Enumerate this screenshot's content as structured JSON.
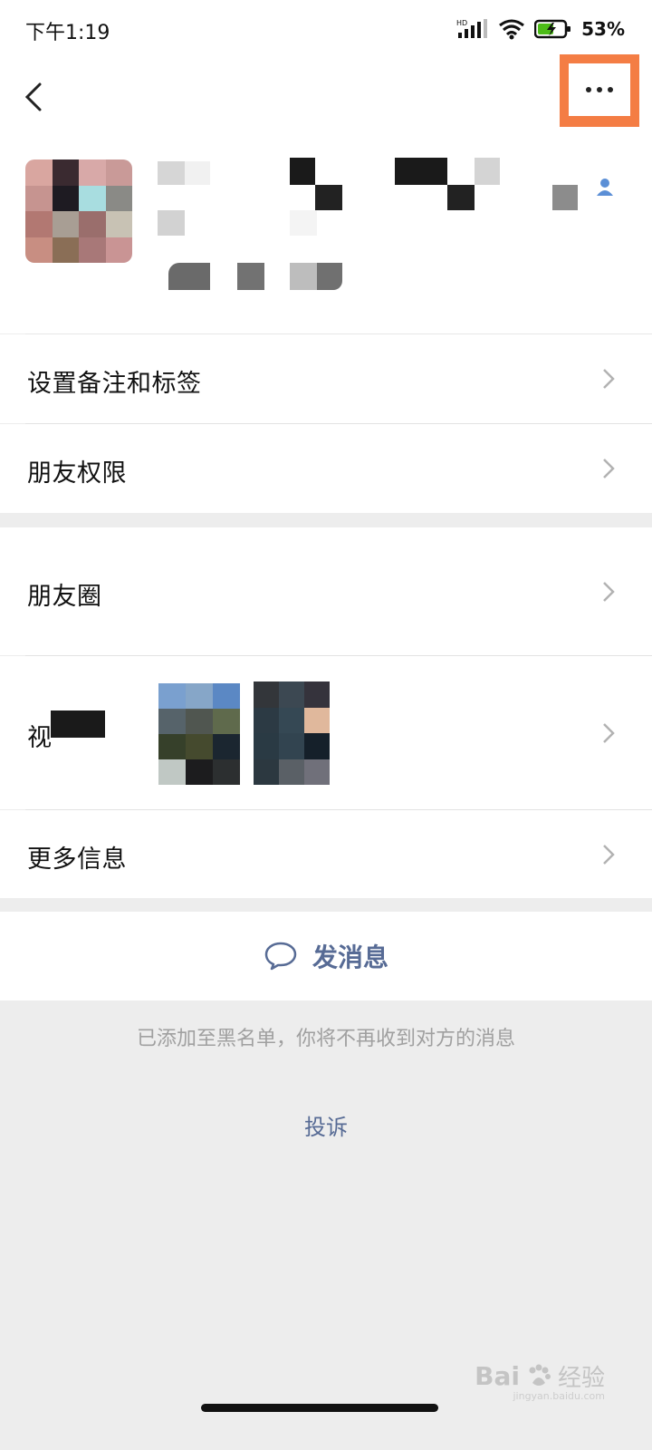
{
  "status_bar": {
    "time": "下午1:19",
    "network": "HD",
    "battery": "53%"
  },
  "nav": {
    "back_icon": "chevron-left-icon",
    "more_icon": "more-dots-icon"
  },
  "menu": {
    "remark_tags": "设置备注和标签",
    "permissions": "朋友权限",
    "moments": "朋友圈",
    "channels": "视",
    "more_info": "更多信息"
  },
  "actions": {
    "send_message": "发消息",
    "blocked_notice": "已添加至黑名单，你将不再收到对方的消息",
    "complain": "投诉"
  },
  "watermark": {
    "brand": "Bai",
    "suffix": "经验",
    "url": "jingyan.baidu.com"
  },
  "colors": {
    "link": "#576b95",
    "highlight": "#f47d44",
    "background": "#ededed"
  }
}
